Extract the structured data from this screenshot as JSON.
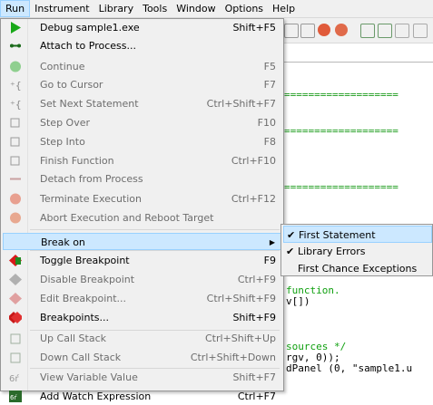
{
  "menubar": [
    {
      "label": "Run",
      "active": true
    },
    {
      "label": "Instrument"
    },
    {
      "label": "Library"
    },
    {
      "label": "Tools"
    },
    {
      "label": "Window"
    },
    {
      "label": "Options"
    },
    {
      "label": "Help"
    }
  ],
  "run_menu": {
    "items": [
      {
        "label": "Debug sample1.exe",
        "shortcut": "Shift+F5",
        "enabled": true,
        "icon": "run-icon"
      },
      {
        "label": "Attach to Process...",
        "shortcut": "",
        "enabled": true,
        "icon": "attach-icon"
      },
      {
        "label": "Continue",
        "shortcut": "F5",
        "enabled": false,
        "icon": "continue-icon"
      },
      {
        "label": "Go to Cursor",
        "shortcut": "F7",
        "enabled": false,
        "icon": "go-to-cursor-icon"
      },
      {
        "label": "Set Next Statement",
        "shortcut": "Ctrl+Shift+F7",
        "enabled": false,
        "icon": "set-next-statement-icon"
      },
      {
        "label": "Step Over",
        "shortcut": "F10",
        "enabled": false,
        "icon": "step-over-icon"
      },
      {
        "label": "Step Into",
        "shortcut": "F8",
        "enabled": false,
        "icon": "step-into-icon"
      },
      {
        "label": "Finish Function",
        "shortcut": "Ctrl+F10",
        "enabled": false,
        "icon": "finish-function-icon"
      },
      {
        "label": "Detach from Process",
        "shortcut": "",
        "enabled": false,
        "icon": "detach-icon"
      },
      {
        "label": "Terminate Execution",
        "shortcut": "Ctrl+F12",
        "enabled": false,
        "icon": "terminate-icon"
      },
      {
        "label": "Abort Execution and Reboot Target",
        "shortcut": "",
        "enabled": false,
        "icon": "abort-icon"
      },
      {
        "label": "Break on",
        "shortcut": "",
        "enabled": true,
        "submenu": true,
        "highlighted": true
      },
      {
        "label": "Toggle Breakpoint",
        "shortcut": "F9",
        "enabled": true,
        "icon": "toggle-breakpoint-icon"
      },
      {
        "label": "Disable Breakpoint",
        "shortcut": "Ctrl+F9",
        "enabled": false,
        "icon": "disable-breakpoint-icon"
      },
      {
        "label": "Edit Breakpoint...",
        "shortcut": "Ctrl+Shift+F9",
        "enabled": false,
        "icon": "edit-breakpoint-icon"
      },
      {
        "label": "Breakpoints...",
        "shortcut": "Shift+F9",
        "enabled": true,
        "icon": "breakpoints-icon"
      },
      {
        "label": "Up Call Stack",
        "shortcut": "Ctrl+Shift+Up",
        "enabled": false,
        "icon": "up-call-stack-icon"
      },
      {
        "label": "Down Call Stack",
        "shortcut": "Ctrl+Shift+Down",
        "enabled": false,
        "icon": "down-call-stack-icon"
      },
      {
        "label": "View Variable Value",
        "shortcut": "Shift+F7",
        "enabled": false,
        "icon": "view-variable-icon"
      },
      {
        "label": "Add Watch Expression",
        "shortcut": "Ctrl+F7",
        "enabled": true,
        "icon": "add-watch-icon"
      }
    ]
  },
  "break_on_submenu": [
    {
      "label": "First Statement",
      "checked": true,
      "highlighted": true
    },
    {
      "label": "Library Errors",
      "checked": true
    },
    {
      "label": "First Chance Exceptions",
      "checked": false
    }
  ],
  "check_glyph": "✔",
  "submenu_arrow": "▶",
  "editor": {
    "separator": "===================",
    "lines": [
      "function.",
      "v[])",
      "sources */",
      "rgv, 0));",
      "dPanel (0, \"sample1.u"
    ]
  },
  "colors": {
    "highlight": "#cce8ff",
    "highlight_border": "#99d1ff",
    "disabled_text": "#6d6d6d",
    "comment": "#10a010"
  }
}
